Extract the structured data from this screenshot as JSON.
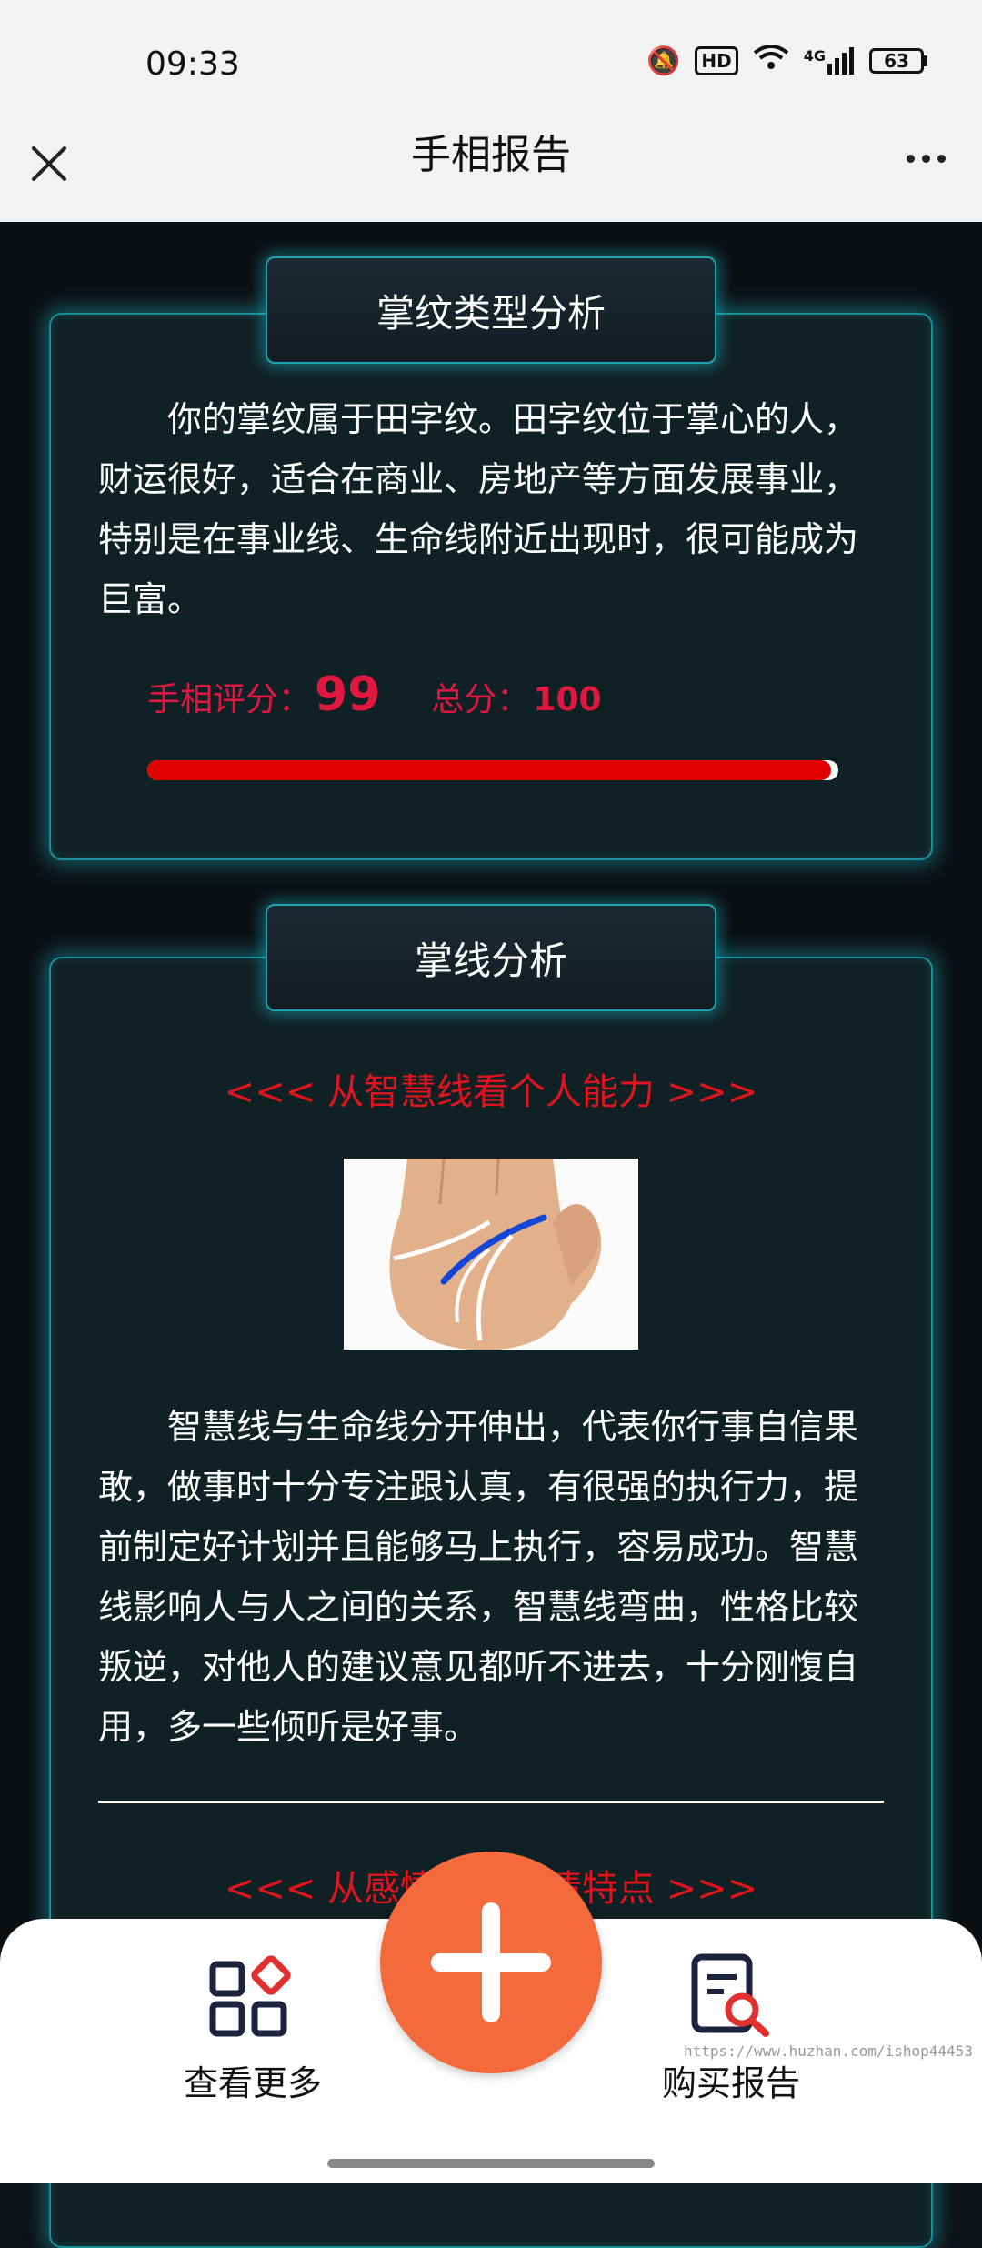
{
  "status": {
    "time": "09:33",
    "hd": "HD",
    "network": "4G",
    "battery": "63"
  },
  "header": {
    "title": "手相报告"
  },
  "palm_type": {
    "tab_title": "掌纹类型分析",
    "description": "你的掌纹属于田字纹。田字纹位于掌心的人，财运很好，适合在商业、房地产等方面发展事业，特别是在事业线、生命线附近出现时，很可能成为巨富。",
    "score_label": "手相评分：",
    "score": "99",
    "total_label": "总分：",
    "total": "100",
    "score_fraction": 0.99
  },
  "palm_lines": {
    "tab_title": "掌线分析",
    "section1_heading": "<<< 从智慧线看个人能力 >>>",
    "section1_text": "智慧线与生命线分开伸出，代表你行事自信果敢，做事时十分专注跟认真，有很强的执行力，提前制定好计划并且能够马上执行，容易成功。智慧线影响人与人之间的关系，智慧线弯曲，性格比较叛逆，对他人的建议意见都听不进去，十分刚愎自用，多一些倾听是好事。",
    "section2_heading": "<<< 从感情线看感情特点 >>>"
  },
  "bottom_nav": {
    "more_label": "查看更多",
    "buy_label": "购买报告"
  },
  "watermark": "https://www.huzhan.com/ishop44453",
  "colors": {
    "accent": "#f36b3d",
    "score": "#e0173e",
    "heading_red": "#e0141c",
    "card_border": "#1fa3b0"
  }
}
